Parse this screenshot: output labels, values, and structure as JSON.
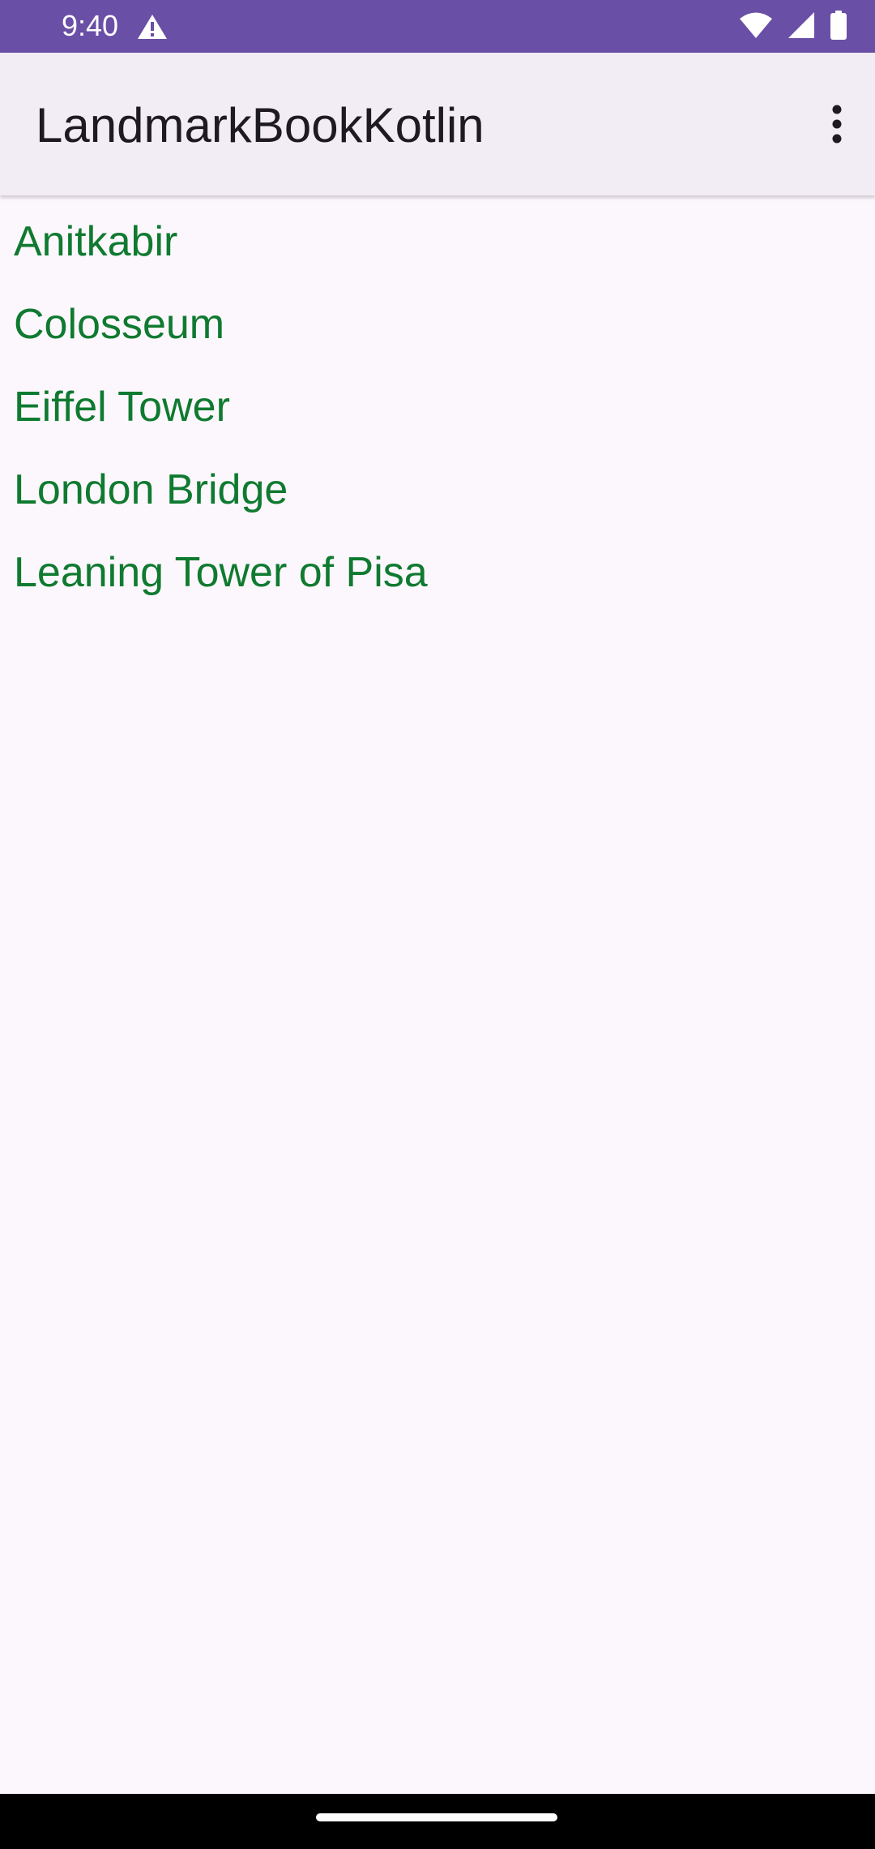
{
  "status_bar": {
    "time": "9:40",
    "icons": [
      "alert-triangle-icon",
      "wifi-icon",
      "cellular-signal-icon",
      "battery-icon"
    ],
    "background_color": "#6a4fa6"
  },
  "app_bar": {
    "title": "LandmarkBookKotlin",
    "overflow_icon": "more-vert-icon",
    "background_color": "#f2ecf5"
  },
  "landmarks": {
    "items": [
      {
        "label": "Anitkabir"
      },
      {
        "label": "Colosseum"
      },
      {
        "label": "Eiffel Tower"
      },
      {
        "label": "London Bridge"
      },
      {
        "label": "Leaning Tower of Pisa"
      }
    ],
    "text_color": "#0f7a30"
  },
  "nav_bar": {
    "handle_icon": "home-gesture-handle-icon"
  }
}
